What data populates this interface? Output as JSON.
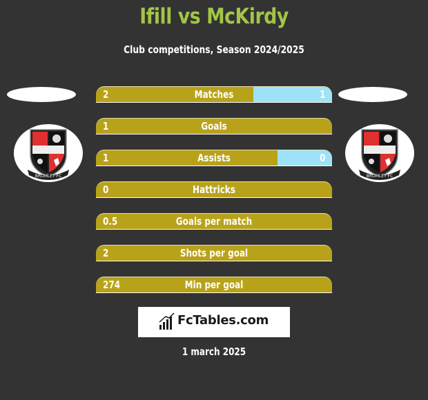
{
  "header": {
    "title": "Ifill vs McKirdy",
    "subtitle": "Club competitions, Season 2024/2025"
  },
  "players": {
    "left": {
      "name": "Ifill",
      "club_logo": "bromley-fc-crest"
    },
    "right": {
      "name": "McKirdy",
      "club_logo": "bromley-fc-crest"
    }
  },
  "colors": {
    "title": "#a3c646",
    "left_bar": "#b8a21a",
    "right_bar": "#9de2f8",
    "background": "#333333"
  },
  "stats": [
    {
      "label": "Matches",
      "left": "2",
      "right": "1",
      "right_share": 0.3333
    },
    {
      "label": "Goals",
      "left": "1",
      "right": "",
      "right_share": 0
    },
    {
      "label": "Assists",
      "left": "1",
      "right": "0",
      "right_share": 0.23
    },
    {
      "label": "Hattricks",
      "left": "0",
      "right": "",
      "right_share": 0
    },
    {
      "label": "Goals per match",
      "left": "0.5",
      "right": "",
      "right_share": 0
    },
    {
      "label": "Shots per goal",
      "left": "2",
      "right": "",
      "right_share": 0
    },
    {
      "label": "Min per goal",
      "left": "274",
      "right": "",
      "right_share": 0
    }
  ],
  "brand": {
    "name": "FcTables.com",
    "icon": "bar-chart-icon"
  },
  "footer": {
    "date": "1 march 2025"
  }
}
